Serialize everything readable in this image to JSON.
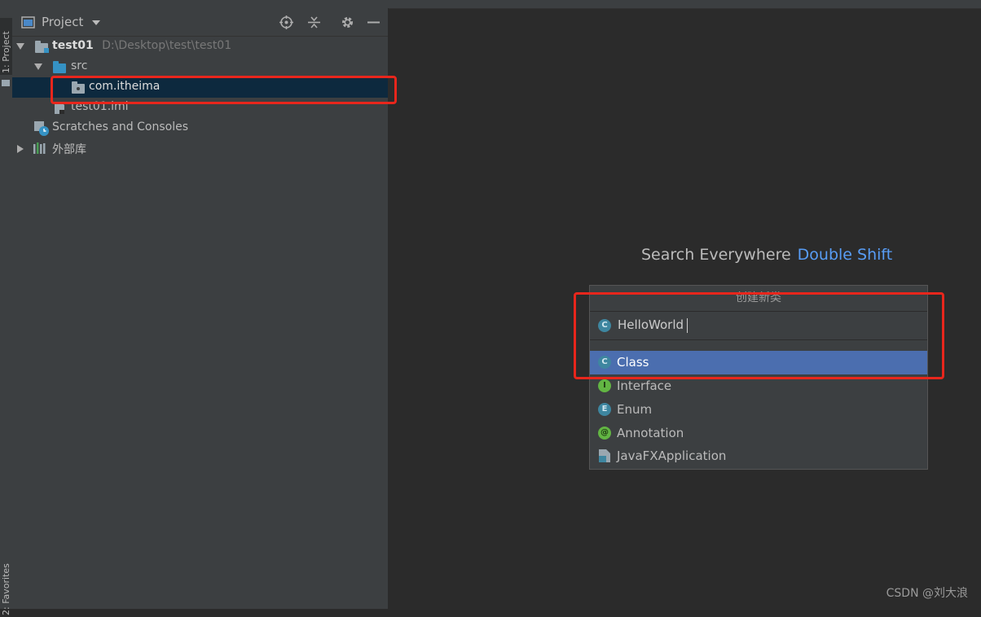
{
  "sidebar_tabs": {
    "project": "1: Project",
    "favorites": "2: Favorites"
  },
  "project_panel": {
    "title": "Project",
    "tree": [
      {
        "label": "test01",
        "path": "D:\\Desktop\\test\\test01"
      },
      {
        "label": "src"
      },
      {
        "label": "com.itheima"
      },
      {
        "label": "test01.iml"
      },
      {
        "label": "Scratches and Consoles"
      },
      {
        "label": "外部库"
      }
    ]
  },
  "editor_hint": {
    "label": "Search Everywhere",
    "shortcut": "Double Shift"
  },
  "new_class_popup": {
    "title": "创建新类",
    "input_value": "HelloWorld",
    "items": [
      {
        "label": "Class",
        "icon": "C"
      },
      {
        "label": "Interface",
        "icon": "I"
      },
      {
        "label": "Enum",
        "icon": "E"
      },
      {
        "label": "Annotation",
        "icon": "@"
      },
      {
        "label": "JavaFXApplication",
        "icon": "javafx-file-icon"
      }
    ]
  },
  "watermark": "CSDN @刘大浪",
  "colors": {
    "highlight": "#e8261c",
    "selection": "#4b6eaf",
    "link": "#589df6"
  }
}
